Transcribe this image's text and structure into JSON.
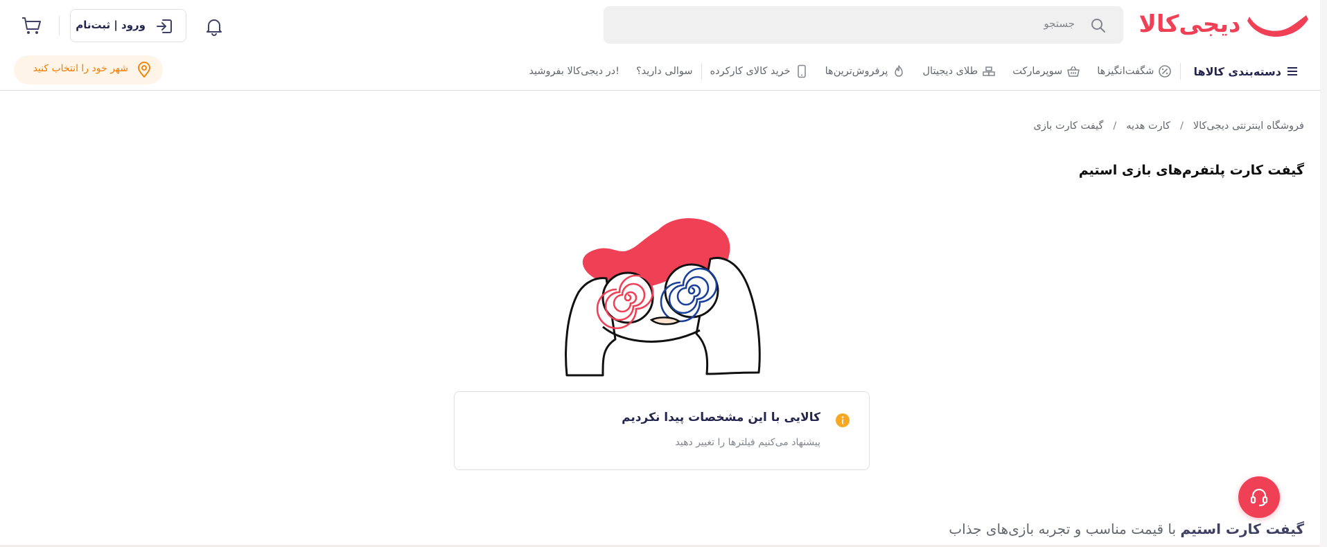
{
  "header": {
    "logo_text": "دیجی‌کالا",
    "search_placeholder": "جستجو",
    "login_label": "ورود | ثبت‌نام",
    "icons": [
      "search-icon",
      "login-icon",
      "bell-icon",
      "cart-icon"
    ]
  },
  "nav": {
    "category_label": "دسته‌بندی کالاها",
    "items": [
      {
        "label": "شگفت‌انگیزها",
        "icon": "percent-icon"
      },
      {
        "label": "سوپرمارکت",
        "icon": "basket-icon"
      },
      {
        "label": "طلای دیجیتال",
        "icon": "gold-icon"
      },
      {
        "label": "پرفروش‌ترین‌ها",
        "icon": "fire-icon"
      },
      {
        "label": "خرید کالای کارکرده",
        "icon": "phone-icon"
      }
    ],
    "extra_items": [
      "سوالی دارید؟",
      "در دیجی‌کالا بفروشید!"
    ],
    "city_label": "شهر خود را انتخاب کنید"
  },
  "breadcrumb": [
    "فروشگاه اینترنتی دیجی‌کالا",
    "کارت هدیه",
    "گیفت کارت بازی"
  ],
  "breadcrumb_separator": "/",
  "page_title": "گیفت کارت پلتفرم‌های بازی استیم",
  "empty_state": {
    "title": "کالایی با این مشخصات پیدا نکردیم",
    "subtitle": "پیشنهاد می‌کنیم فیلترها را تغییر دهید"
  },
  "footer_heading": {
    "bold": "گیفت کارت استیم",
    "rest": " با قیمت مناسب و تجربه بازی‌های جذاب"
  },
  "colors": {
    "brand": "#ef4056",
    "city_accent": "#f57c00",
    "info": "#f9a825"
  }
}
